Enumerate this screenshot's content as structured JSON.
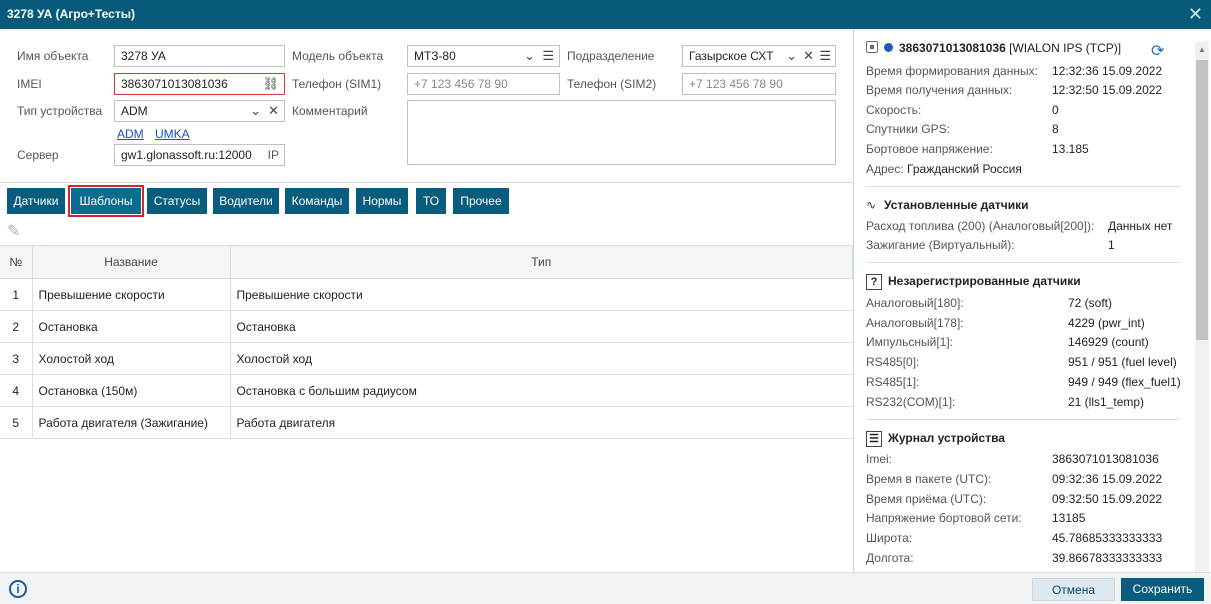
{
  "window": {
    "title": "3278 УА (Агро+Тесты)"
  },
  "form": {
    "name_label": "Имя объекта",
    "name_value": "3278 УА",
    "model_label": "Модель объекта",
    "model_value": "МТЗ-80",
    "division_label": "Подразделение",
    "division_value": "Газырское СХТ",
    "imei_label": "IMEI",
    "imei_value": "3863071013081036",
    "phone1_label": "Телефон (SIM1)",
    "phone1_placeholder": "+7 123 456 78 90",
    "phone2_label": "Телефон (SIM2)",
    "phone2_placeholder": "+7 123 456 78 90",
    "device_type_label": "Тип устройства",
    "device_type_value": "ADM",
    "comment_label": "Комментарий",
    "device_links": [
      "ADM",
      "UMKA"
    ],
    "server_label": "Сервер",
    "server_value": "gw1.glonassoft.ru:12000",
    "server_ip_label": "IP"
  },
  "tabs": [
    {
      "label": "Датчики",
      "active": false
    },
    {
      "label": "Шаблоны",
      "active": true
    },
    {
      "label": "Статусы",
      "active": false
    },
    {
      "label": "Водители",
      "active": false
    },
    {
      "label": "Команды",
      "active": false
    },
    {
      "label": "Нормы",
      "active": false
    },
    {
      "label": "ТО",
      "active": false
    },
    {
      "label": "Прочее",
      "active": false
    }
  ],
  "table": {
    "headers": [
      "№",
      "Название",
      "Тип"
    ],
    "rows": [
      [
        "1",
        "Превышение скорости",
        "Превышение скорости"
      ],
      [
        "2",
        "Остановка",
        "Остановка"
      ],
      [
        "3",
        "Холостой ход",
        "Холостой ход"
      ],
      [
        "4",
        "Остановка (150м)",
        "Остановка с большим радиусом"
      ],
      [
        "5",
        "Работа двигателя (Зажигание)",
        "Работа двигателя"
      ]
    ]
  },
  "panel": {
    "device_id": "3863071013081036",
    "protocol": "[WIALON IPS (TCP)]",
    "status_color": "#1d5fb0",
    "info": [
      {
        "k": "Время формирования данных:",
        "v": "12:32:36 15.09.2022"
      },
      {
        "k": "Время получения данных:",
        "v": "12:32:50 15.09.2022"
      },
      {
        "k": "Скорость:",
        "v": "0"
      },
      {
        "k": "Спутники GPS:",
        "v": "8"
      },
      {
        "k": "Бортовое напряжение:",
        "v": "13.185"
      }
    ],
    "address_label": "Адрес:",
    "address_value": "Гражданский Россия",
    "installed_title": "Установленные датчики",
    "installed": [
      {
        "k": "Расход топлива (200) (Аналоговый[200]):",
        "v": "Данных нет"
      },
      {
        "k": "Зажигание (Виртуальный):",
        "v": "1"
      }
    ],
    "unreg_title": "Незарегистрированные датчики",
    "unreg": [
      {
        "k": "Аналоговый[180]:",
        "v": "72 (soft)"
      },
      {
        "k": "Аналоговый[178]:",
        "v": "4229 (pwr_int)"
      },
      {
        "k": "Импульсный[1]:",
        "v": "146929 (count)"
      },
      {
        "k": "RS485[0]:",
        "v": "951 / 951 (fuel level)"
      },
      {
        "k": "RS485[1]:",
        "v": "949 / 949 (flex_fuel1)"
      },
      {
        "k": "RS232(COM)[1]:",
        "v": "21 (lls1_temp)"
      }
    ],
    "journal_title": "Журнал устройства",
    "journal": [
      {
        "k": "Imei:",
        "v": "3863071013081036"
      },
      {
        "k": "Время в пакете (UTC):",
        "v": "09:32:36 15.09.2022"
      },
      {
        "k": "Время приёма (UTC):",
        "v": "09:32:50 15.09.2022"
      },
      {
        "k": "Напряжение бортовой сети:",
        "v": "13185"
      },
      {
        "k": "Широта:",
        "v": "45.78685333333333"
      },
      {
        "k": "Долгота:",
        "v": "39.86678333333333"
      }
    ]
  },
  "footer": {
    "cancel_label": "Отмена",
    "save_label": "Сохранить"
  },
  "colors": {
    "primary": "#085d7e",
    "highlight": "#d8232a"
  }
}
